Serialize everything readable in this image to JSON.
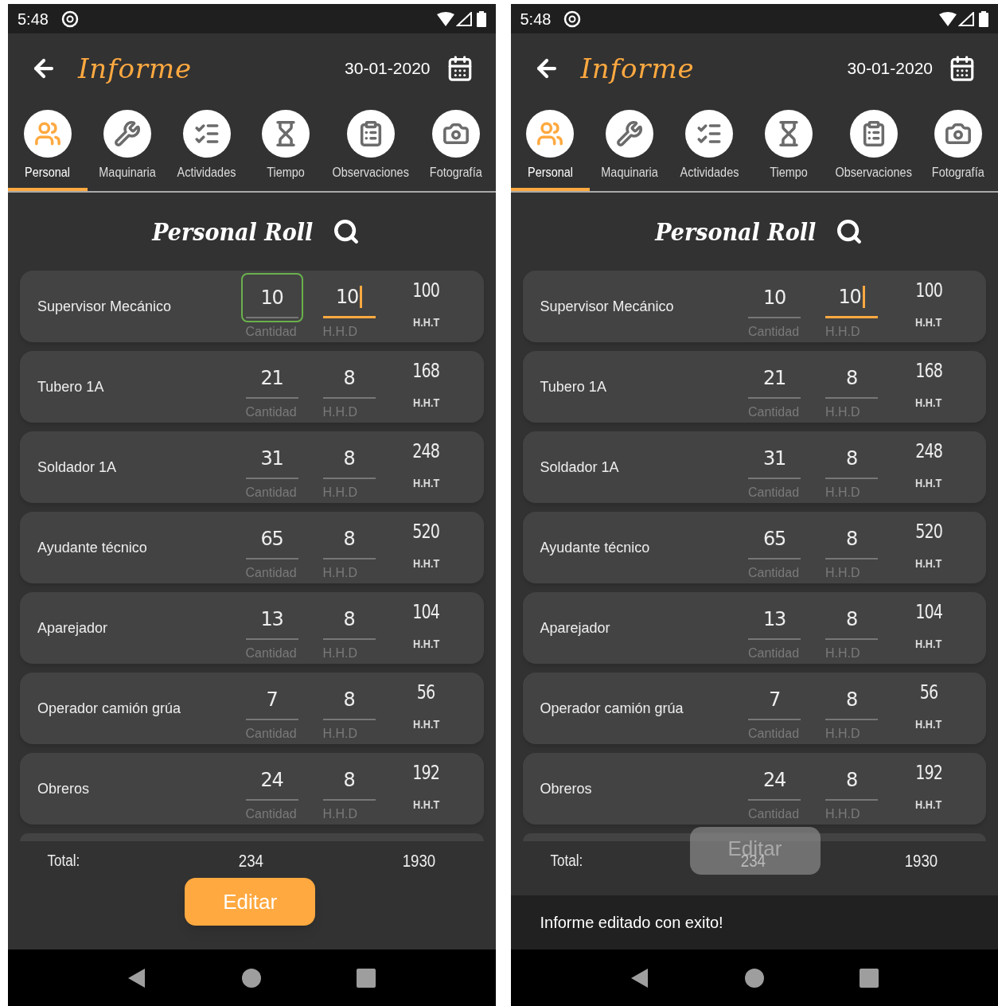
{
  "screens": [
    {
      "status_bar": {
        "time": "5:48"
      },
      "header": {
        "title": "Informe",
        "date": "30-01-2020"
      },
      "tabs": [
        {
          "label": "Personal",
          "selected": true
        },
        {
          "label": "Maquinaria",
          "selected": false
        },
        {
          "label": "Actividades",
          "selected": false
        },
        {
          "label": "Tiempo",
          "selected": false
        },
        {
          "label": "Observaciones",
          "selected": false
        },
        {
          "label": "Fotografía",
          "selected": false
        }
      ],
      "section_title": "Personal Roll",
      "rows": [
        {
          "role": "Supervisor Mecánico",
          "fields": [
            {
              "kind": "input",
              "value": "10",
              "label": "Cantidad",
              "outlined": true,
              "active": false
            },
            {
              "kind": "input",
              "value": "10",
              "label": "H.H.D",
              "outlined": false,
              "active": true
            },
            {
              "kind": "readout",
              "value": "100",
              "label": "H.H.T"
            }
          ]
        },
        {
          "role": "Tubero 1A",
          "fields": [
            {
              "kind": "input",
              "value": "21",
              "label": "Cantidad",
              "outlined": false,
              "active": false
            },
            {
              "kind": "input",
              "value": "8",
              "label": "H.H.D",
              "outlined": false,
              "active": false
            },
            {
              "kind": "readout",
              "value": "168",
              "label": "H.H.T"
            }
          ]
        },
        {
          "role": "Soldador 1A",
          "fields": [
            {
              "kind": "input",
              "value": "31",
              "label": "Cantidad",
              "outlined": false,
              "active": false
            },
            {
              "kind": "input",
              "value": "8",
              "label": "H.H.D",
              "outlined": false,
              "active": false
            },
            {
              "kind": "readout",
              "value": "248",
              "label": "H.H.T"
            }
          ]
        },
        {
          "role": "Ayudante técnico",
          "fields": [
            {
              "kind": "input",
              "value": "65",
              "label": "Cantidad",
              "outlined": false,
              "active": false
            },
            {
              "kind": "input",
              "value": "8",
              "label": "H.H.D",
              "outlined": false,
              "active": false
            },
            {
              "kind": "readout",
              "value": "520",
              "label": "H.H.T"
            }
          ]
        },
        {
          "role": "Aparejador",
          "fields": [
            {
              "kind": "input",
              "value": "13",
              "label": "Cantidad",
              "outlined": false,
              "active": false
            },
            {
              "kind": "input",
              "value": "8",
              "label": "H.H.D",
              "outlined": false,
              "active": false
            },
            {
              "kind": "readout",
              "value": "104",
              "label": "H.H.T"
            }
          ]
        },
        {
          "role": "Operador camión grúa",
          "fields": [
            {
              "kind": "input",
              "value": "7",
              "label": "Cantidad",
              "outlined": false,
              "active": false
            },
            {
              "kind": "input",
              "value": "8",
              "label": "H.H.D",
              "outlined": false,
              "active": false
            },
            {
              "kind": "readout",
              "value": "56",
              "label": "H.H.T"
            }
          ]
        },
        {
          "role": "Obreros",
          "fields": [
            {
              "kind": "input",
              "value": "24",
              "label": "Cantidad",
              "outlined": false,
              "active": false
            },
            {
              "kind": "input",
              "value": "8",
              "label": "H.H.D",
              "outlined": false,
              "active": false
            },
            {
              "kind": "readout",
              "value": "192",
              "label": "H.H.T"
            }
          ]
        }
      ],
      "total": {
        "label": "Total:",
        "cantidad": "234",
        "hht": "1930"
      },
      "button": {
        "label": "Editar",
        "faded": false
      }
    },
    {
      "status_bar": {
        "time": "5:48"
      },
      "header": {
        "title": "Informe",
        "date": "30-01-2020"
      },
      "tabs": [
        {
          "label": "Personal",
          "selected": true
        },
        {
          "label": "Maquinaria",
          "selected": false
        },
        {
          "label": "Actividades",
          "selected": false
        },
        {
          "label": "Tiempo",
          "selected": false
        },
        {
          "label": "Observaciones",
          "selected": false
        },
        {
          "label": "Fotografía",
          "selected": false
        }
      ],
      "section_title": "Personal Roll",
      "rows": [
        {
          "role": "Supervisor Mecánico",
          "fields": [
            {
              "kind": "input",
              "value": "10",
              "label": "Cantidad",
              "outlined": false,
              "active": false
            },
            {
              "kind": "input",
              "value": "10",
              "label": "H.H.D",
              "outlined": false,
              "active": true
            },
            {
              "kind": "readout",
              "value": "100",
              "label": "H.H.T"
            }
          ]
        },
        {
          "role": "Tubero 1A",
          "fields": [
            {
              "kind": "input",
              "value": "21",
              "label": "Cantidad",
              "outlined": false,
              "active": false
            },
            {
              "kind": "input",
              "value": "8",
              "label": "H.H.D",
              "outlined": false,
              "active": false
            },
            {
              "kind": "readout",
              "value": "168",
              "label": "H.H.T"
            }
          ]
        },
        {
          "role": "Soldador 1A",
          "fields": [
            {
              "kind": "input",
              "value": "31",
              "label": "Cantidad",
              "outlined": false,
              "active": false
            },
            {
              "kind": "input",
              "value": "8",
              "label": "H.H.D",
              "outlined": false,
              "active": false
            },
            {
              "kind": "readout",
              "value": "248",
              "label": "H.H.T"
            }
          ]
        },
        {
          "role": "Ayudante técnico",
          "fields": [
            {
              "kind": "input",
              "value": "65",
              "label": "Cantidad",
              "outlined": false,
              "active": false
            },
            {
              "kind": "input",
              "value": "8",
              "label": "H.H.D",
              "outlined": false,
              "active": false
            },
            {
              "kind": "readout",
              "value": "520",
              "label": "H.H.T"
            }
          ]
        },
        {
          "role": "Aparejador",
          "fields": [
            {
              "kind": "input",
              "value": "13",
              "label": "Cantidad",
              "outlined": false,
              "active": false
            },
            {
              "kind": "input",
              "value": "8",
              "label": "H.H.D",
              "outlined": false,
              "active": false
            },
            {
              "kind": "readout",
              "value": "104",
              "label": "H.H.T"
            }
          ]
        },
        {
          "role": "Operador camión grúa",
          "fields": [
            {
              "kind": "input",
              "value": "7",
              "label": "Cantidad",
              "outlined": false,
              "active": false
            },
            {
              "kind": "input",
              "value": "8",
              "label": "H.H.D",
              "outlined": false,
              "active": false
            },
            {
              "kind": "readout",
              "value": "56",
              "label": "H.H.T"
            }
          ]
        },
        {
          "role": "Obreros",
          "fields": [
            {
              "kind": "input",
              "value": "24",
              "label": "Cantidad",
              "outlined": false,
              "active": false
            },
            {
              "kind": "input",
              "value": "8",
              "label": "H.H.D",
              "outlined": false,
              "active": false
            },
            {
              "kind": "readout",
              "value": "192",
              "label": "H.H.T"
            }
          ]
        }
      ],
      "total": {
        "label": "Total:",
        "cantidad": "234",
        "hht": "1930"
      },
      "button": {
        "label": "Editar",
        "faded": true
      },
      "snackbar": {
        "message": "Informe editado con exito!"
      }
    }
  ]
}
